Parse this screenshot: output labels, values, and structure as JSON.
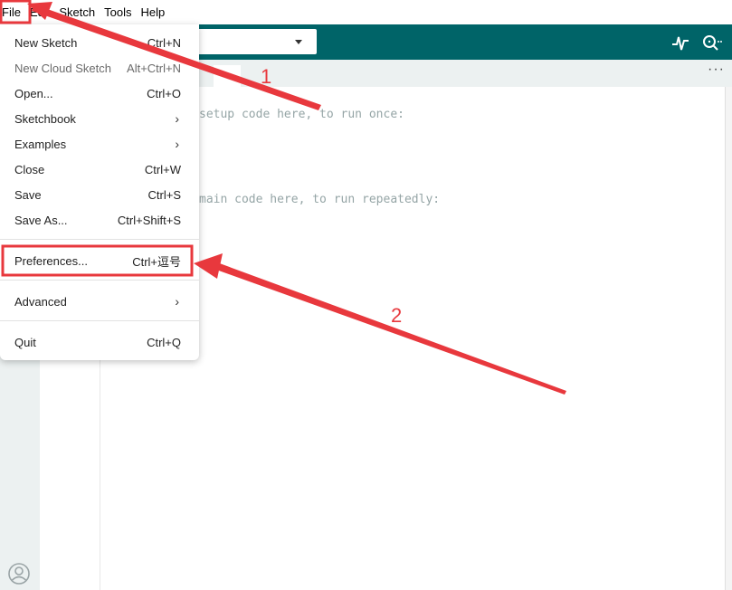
{
  "menubar": {
    "items": [
      "File",
      "Edit",
      "Sketch",
      "Tools",
      "Help"
    ]
  },
  "toolbar": {
    "board_select_value": "",
    "serial_plotter_icon": "pulse-icon",
    "serial_monitor_icon": "serial-monitor-icon"
  },
  "tabs": {
    "more_label": "···"
  },
  "editor": {
    "lines": [
      "setup code here, to run once:",
      "main code here, to run repeatedly:"
    ]
  },
  "file_menu": {
    "items": [
      {
        "label": "New Sketch",
        "shortcut": "Ctrl+N",
        "disabled": false
      },
      {
        "label": "New Cloud Sketch",
        "shortcut": "Alt+Ctrl+N",
        "disabled": true
      },
      {
        "label": "Open...",
        "shortcut": "Ctrl+O",
        "disabled": false
      },
      {
        "label": "Sketchbook",
        "shortcut": "›",
        "submenu": true
      },
      {
        "label": "Examples",
        "shortcut": "›",
        "submenu": true
      },
      {
        "label": "Close",
        "shortcut": "Ctrl+W",
        "disabled": false
      },
      {
        "label": "Save",
        "shortcut": "Ctrl+S",
        "disabled": false
      },
      {
        "label": "Save As...",
        "shortcut": "Ctrl+Shift+S",
        "disabled": false
      },
      {
        "label": "Preferences...",
        "shortcut": "Ctrl+逗号",
        "disabled": false
      },
      {
        "label": "Advanced",
        "shortcut": "›",
        "submenu": true
      },
      {
        "label": "Quit",
        "shortcut": "Ctrl+Q",
        "disabled": false
      }
    ]
  },
  "annotations": {
    "step1": "1",
    "step2": "2",
    "color": "#e8383d"
  },
  "colors": {
    "toolbar": "#006468",
    "sidebar": "#ecf1f1"
  }
}
